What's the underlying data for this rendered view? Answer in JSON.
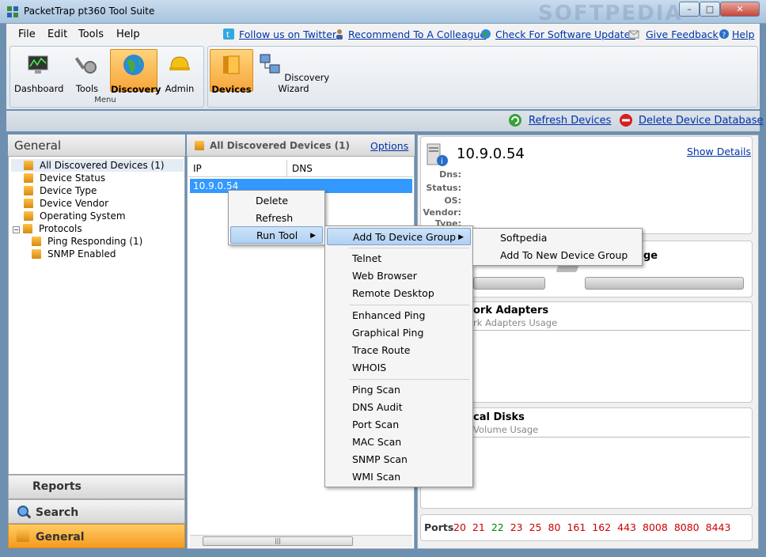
{
  "window": {
    "title": "PacketTrap pt360 Tool Suite",
    "watermark": "SOFTPEDIA"
  },
  "menubar": {
    "items": [
      "File",
      "Edit",
      "Tools",
      "Help"
    ]
  },
  "links": {
    "twitter": "Follow us on Twitter",
    "recommend": "Recommend To A Colleague",
    "updates": "Check For Software Updates",
    "feedback": "Give Feedback",
    "help": "Help"
  },
  "ribbon": {
    "menu_group": [
      "Dashboard",
      "Tools",
      "Discovery",
      "Admin"
    ],
    "menu_label": "Menu",
    "devices_group": [
      "Devices",
      "Discovery Wizard"
    ]
  },
  "toolbar": {
    "refresh": "Refresh Devices",
    "delete_db": "Delete Device Database"
  },
  "left": {
    "header": "General",
    "tree": [
      {
        "label": "All Discovered Devices (1)",
        "level": 0
      },
      {
        "label": "Device Status",
        "level": 0
      },
      {
        "label": "Device Type",
        "level": 0
      },
      {
        "label": "Device Vendor",
        "level": 0
      },
      {
        "label": "Operating System",
        "level": 0
      },
      {
        "label": "Protocols",
        "level": 0
      },
      {
        "label": "Ping Responding (1)",
        "level": 1
      },
      {
        "label": "SNMP Enabled",
        "level": 1
      }
    ],
    "nav": [
      "Reports",
      "Search",
      "General"
    ]
  },
  "middle": {
    "header": "All Discovered Devices (1)",
    "options": "Options",
    "columns": [
      "IP",
      "DNS"
    ],
    "rows": [
      {
        "ip": "10.9.0.54"
      }
    ],
    "scroll_glyph": "|||"
  },
  "right": {
    "ip": "10.9.0.54",
    "show_details": "Show Details",
    "fields": [
      "Dns:",
      "Status:",
      "OS:",
      "Vendor:",
      "Type:"
    ],
    "usage_partial": "ge",
    "adapters_title": "ork Adapters",
    "adapters_sub": "rk Adapters Usage",
    "disks_title": "cal Disks",
    "disks_sub": "Volume Usage",
    "ports_label": "Ports",
    "ports": [
      {
        "n": "20",
        "color": "#cc0000"
      },
      {
        "n": "21",
        "color": "#cc0000"
      },
      {
        "n": "22",
        "color": "#008800"
      },
      {
        "n": "23",
        "color": "#cc0000"
      },
      {
        "n": "25",
        "color": "#cc0000"
      },
      {
        "n": "80",
        "color": "#cc0000"
      },
      {
        "n": "161",
        "color": "#cc0000"
      },
      {
        "n": "162",
        "color": "#cc0000"
      },
      {
        "n": "443",
        "color": "#cc0000"
      },
      {
        "n": "8008",
        "color": "#cc0000"
      },
      {
        "n": "8080",
        "color": "#cc0000"
      },
      {
        "n": "8443",
        "color": "#cc0000"
      }
    ]
  },
  "context_menu": {
    "items": [
      "Delete",
      "Refresh",
      "Run Tool"
    ]
  },
  "run_tool_menu": {
    "group1": [
      "Add To Device Group"
    ],
    "group2": [
      "Telnet",
      "Web Browser",
      "Remote Desktop"
    ],
    "group3": [
      "Enhanced Ping",
      "Graphical Ping",
      "Trace Route",
      "WHOIS"
    ],
    "group4": [
      "Ping Scan",
      "DNS Audit",
      "Port Scan",
      "MAC Scan",
      "SNMP Scan",
      "WMI Scan"
    ]
  },
  "device_group_menu": {
    "items": [
      "Softpedia",
      "Add To New Device Group"
    ]
  }
}
